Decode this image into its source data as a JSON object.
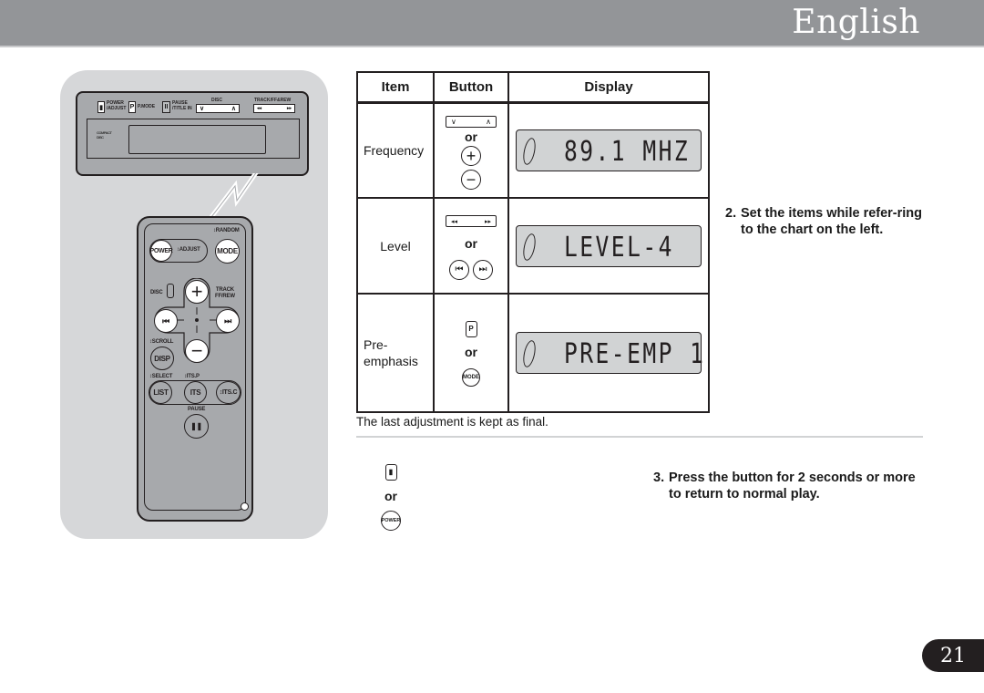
{
  "header": {
    "title": "English"
  },
  "illustration": {
    "head_unit": {
      "buttons": [
        {
          "glyph": "▮",
          "label": "POWER\n/ADJUST"
        },
        {
          "glyph": "P",
          "label": "P.MODE"
        },
        {
          "glyph": "II",
          "label": "PAUSE\n/TITLE IN"
        }
      ],
      "disc_label": "DISC",
      "disc_rocker": {
        "left": "∨",
        "right": "∧"
      },
      "track_label": "TRACK/FF&REW",
      "track_rocker": {
        "left": "◂◂",
        "right": "▸▸"
      },
      "logo": "COMPACT DISC"
    },
    "remote": {
      "random_label": "↕RANDOM",
      "power": "POWER",
      "adjust_label": "↕ADJUST",
      "mode": "MODE",
      "disc_label": "DISC",
      "track_label": "TRACK\nFF/REW",
      "plus": "+",
      "minus": "−",
      "prev": "⏮",
      "next": "⏭",
      "scroll_label": "↕SCROLL",
      "disp": "DISP",
      "select_label": "↕SELECT",
      "itsp_label": "↕ITS.P",
      "list": "LIST",
      "its": "ITS",
      "itsc": "↕ITS.C",
      "pause_label": "PAUSE",
      "pause": "❚❚"
    }
  },
  "table": {
    "headers": [
      "Item",
      "Button",
      "Display"
    ],
    "or": "or",
    "rows": [
      {
        "item": "Frequency",
        "buttons": {
          "rocker_left": "∨",
          "rocker_right": "∧",
          "alt_1": "+",
          "alt_2": "−"
        },
        "display": "89.1 MHZ"
      },
      {
        "item": "Level",
        "buttons": {
          "rocker_left": "◂◂",
          "rocker_right": "▸▸",
          "alt_1": "⏮",
          "alt_2": "⏭"
        },
        "display": "LEVEL-4"
      },
      {
        "item": "Pre-\nemphasis",
        "buttons": {
          "key": "P",
          "alt": "MODE"
        },
        "display": "PRE-EMP 1"
      }
    ]
  },
  "note": "The last adjustment is kept as final.",
  "steps": [
    {
      "num": "2.",
      "text": "Set the items while refer-ring to the chart on the left."
    },
    {
      "num": "3.",
      "text": "Press the button for 2 seconds or more to return to normal play."
    }
  ],
  "step3_buttons": {
    "key": "▮",
    "or": "or",
    "alt": "POWER"
  },
  "page_number": "21"
}
